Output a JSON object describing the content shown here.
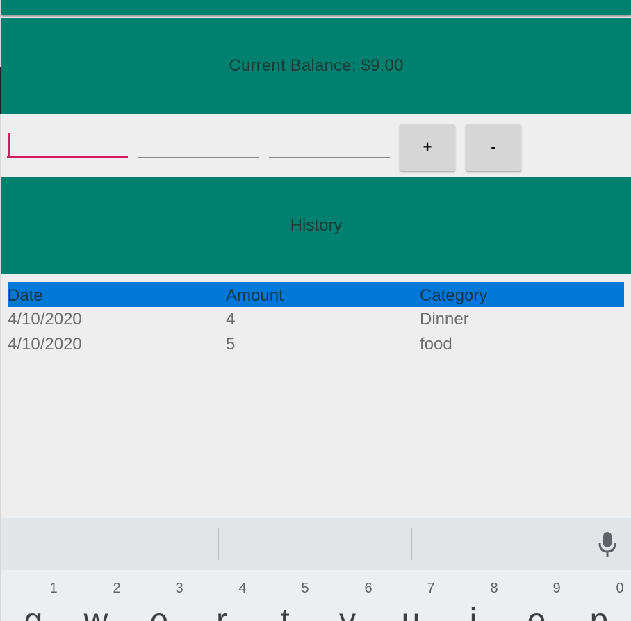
{
  "balance": {
    "label": "Current Balance: $9.00"
  },
  "inputs": {
    "field1_value": "",
    "field2_value": "",
    "field3_value": ""
  },
  "buttons": {
    "add_label": "+",
    "subtract_label": "-"
  },
  "history": {
    "title": "History"
  },
  "table": {
    "headers": [
      "Date",
      "Amount",
      "Category"
    ],
    "rows": [
      [
        "4/10/2020",
        "4",
        "Dinner"
      ],
      [
        "4/10/2020",
        "5",
        "food"
      ]
    ]
  },
  "keyboard": {
    "number_hints": [
      "1",
      "2",
      "3",
      "4",
      "5",
      "6",
      "7",
      "8",
      "9",
      "0"
    ],
    "letters": [
      "q",
      "w",
      "e",
      "r",
      "t",
      "y",
      "u",
      "i",
      "o",
      "p"
    ],
    "mic_icon": "mic-icon"
  },
  "colors": {
    "teal": "#00806e",
    "header_blue": "#0078d7",
    "accent_pink": "#d81b60"
  }
}
